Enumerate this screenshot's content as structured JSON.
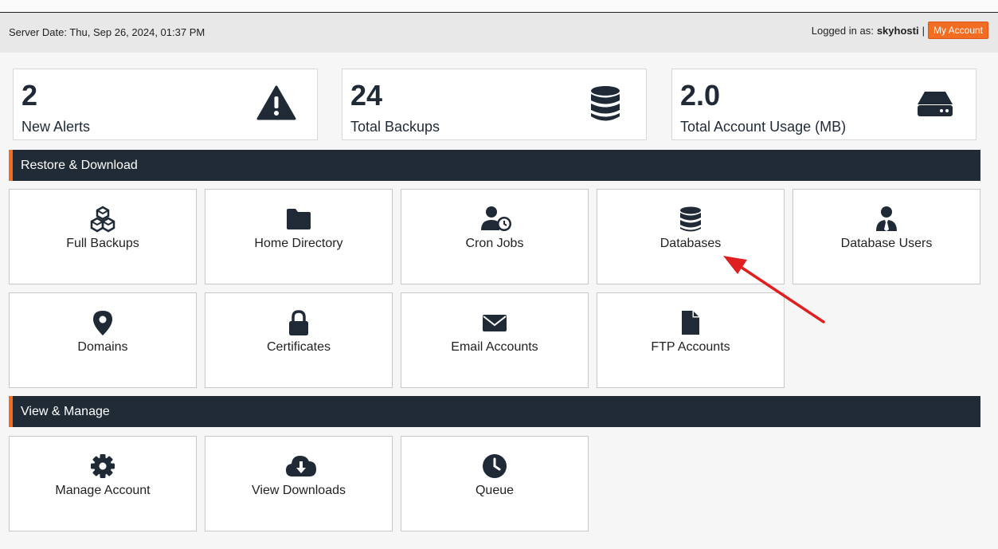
{
  "header": {
    "server_date": "Server Date: Thu, Sep 26, 2024, 01:37 PM",
    "logged_in_label": "Logged in as:",
    "username": "skyhosti",
    "separator": "|",
    "my_account_label": "My Account"
  },
  "stats": [
    {
      "value": "2",
      "label": "New Alerts",
      "icon": "warning-icon"
    },
    {
      "value": "24",
      "label": "Total Backups",
      "icon": "database-icon"
    },
    {
      "value": "2.0",
      "label": "Total Account Usage (MB)",
      "icon": "hard-drive-icon"
    }
  ],
  "sections": {
    "restore": "Restore & Download",
    "manage": "View & Manage"
  },
  "restore_tiles": [
    {
      "label": "Full Backups",
      "icon": "cubes-icon"
    },
    {
      "label": "Home Directory",
      "icon": "folder-icon"
    },
    {
      "label": "Cron Jobs",
      "icon": "user-clock-icon"
    },
    {
      "label": "Databases",
      "icon": "database-icon"
    },
    {
      "label": "Database Users",
      "icon": "user-tie-icon"
    },
    {
      "label": "Domains",
      "icon": "map-pin-icon"
    },
    {
      "label": "Certificates",
      "icon": "lock-icon"
    },
    {
      "label": "Email Accounts",
      "icon": "envelope-icon"
    },
    {
      "label": "FTP Accounts",
      "icon": "file-icon"
    }
  ],
  "manage_tiles": [
    {
      "label": "Manage Account",
      "icon": "gear-icon"
    },
    {
      "label": "View Downloads",
      "icon": "cloud-download-icon"
    },
    {
      "label": "Queue",
      "icon": "clock-icon"
    }
  ],
  "colors": {
    "accent": "#f26d21",
    "dark": "#212b36",
    "icon": "#1f2a36",
    "arrow": "#e02020"
  }
}
